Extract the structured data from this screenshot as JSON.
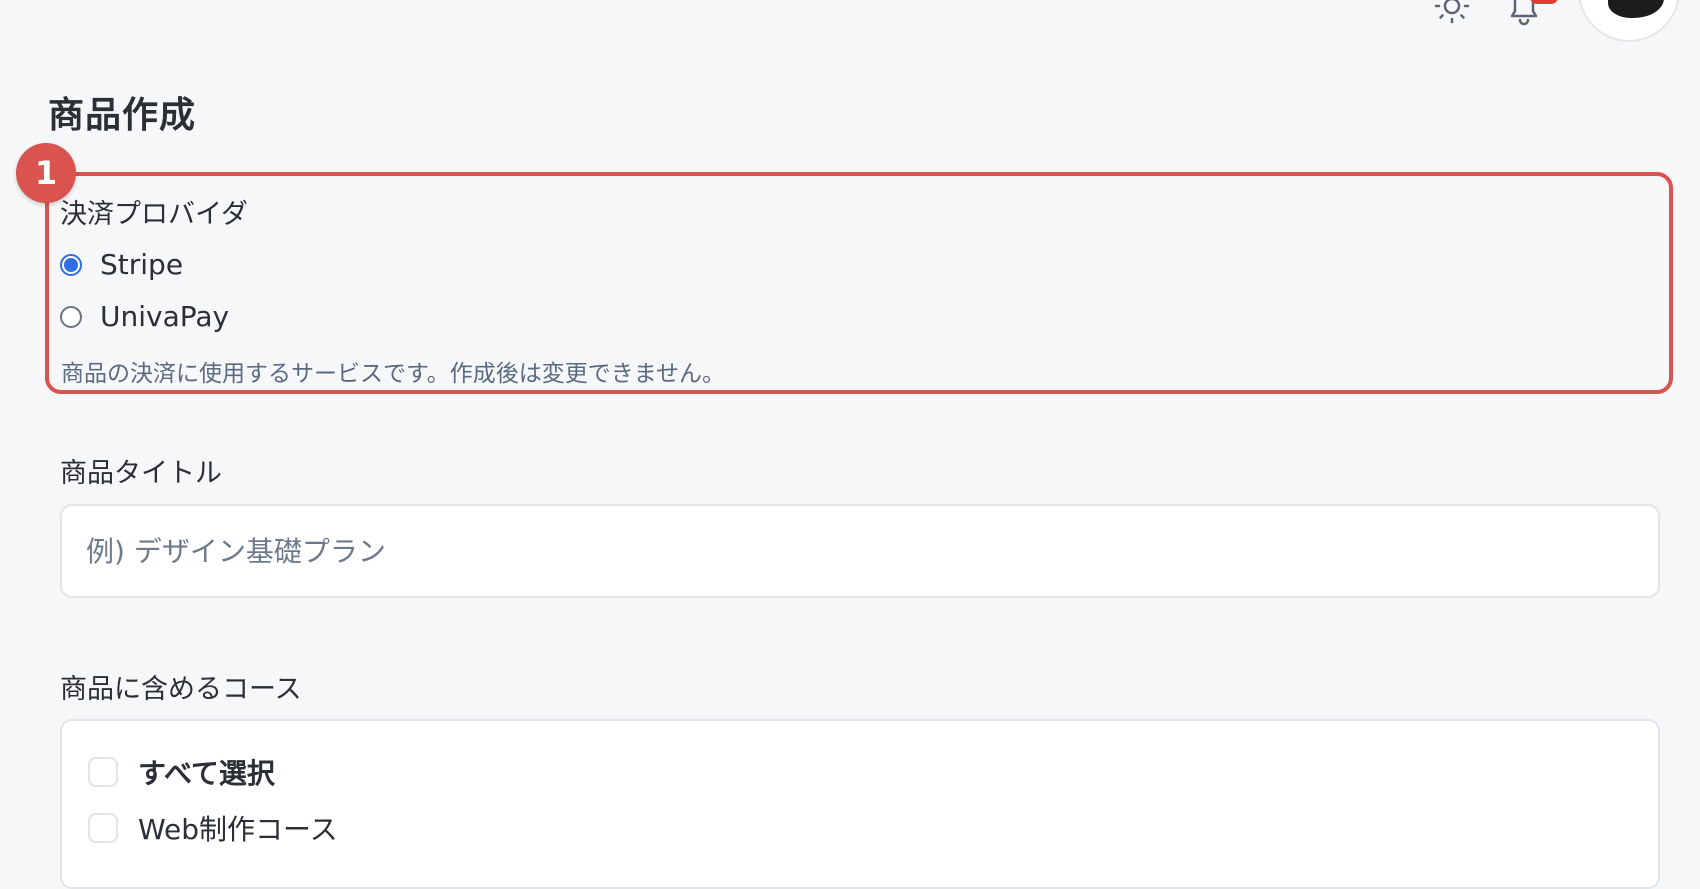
{
  "header": {
    "theme_icon": "sun-icon",
    "notification_icon": "bell-icon",
    "accent_badge_color": "#e53935"
  },
  "page": {
    "title": "商品作成"
  },
  "annotation": {
    "step_number": "1",
    "color": "#d9534f"
  },
  "payment_provider": {
    "label": "決済プロバイダ",
    "options": [
      {
        "label": "Stripe",
        "checked": true
      },
      {
        "label": "UnivaPay",
        "checked": false
      }
    ],
    "help_text": "商品の決済に使用するサービスです。作成後は変更できません。",
    "selected_color": "#2f6fe4"
  },
  "product_title": {
    "label": "商品タイトル",
    "placeholder": "例) デザイン基礎プラン",
    "value": ""
  },
  "courses": {
    "label": "商品に含めるコース",
    "select_all_label": "すべて選択",
    "items": [
      {
        "label": "Web制作コース",
        "checked": false
      }
    ]
  }
}
